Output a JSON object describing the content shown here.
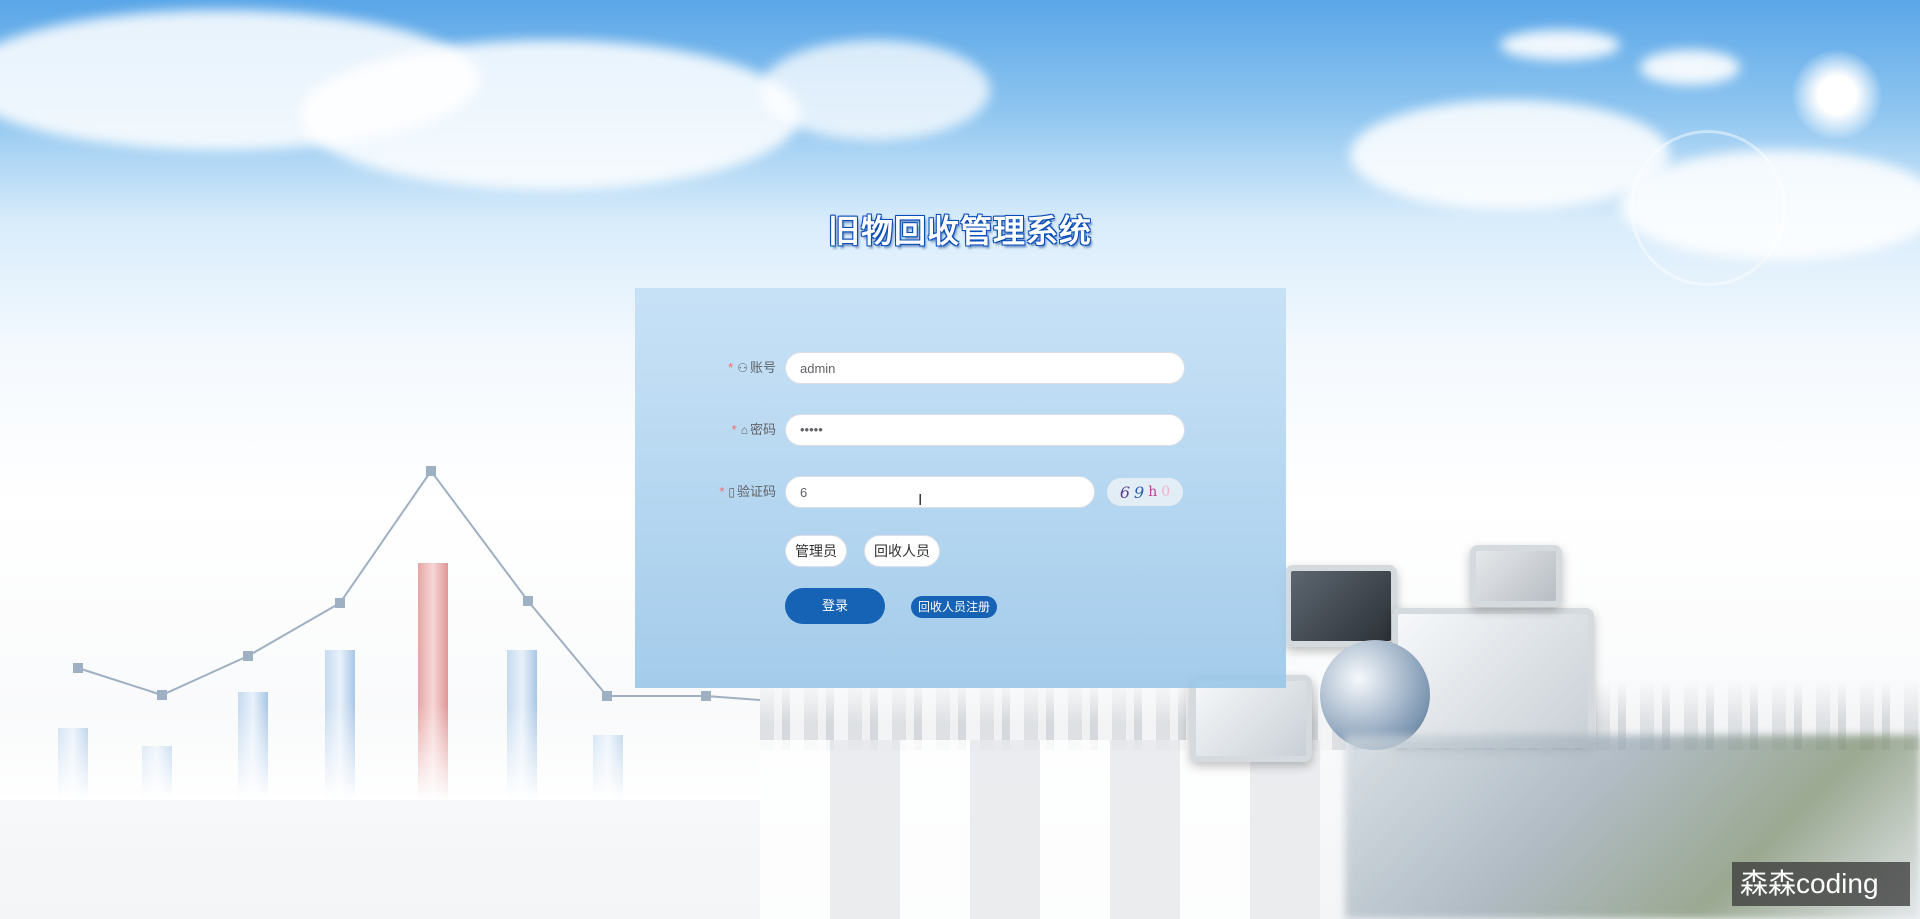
{
  "app": {
    "title": "旧物回收管理系统"
  },
  "form": {
    "account": {
      "label": "账号",
      "icon": "user-icon",
      "value": "admin",
      "required": true
    },
    "password": {
      "label": "密码",
      "icon": "lock-icon",
      "value": "•••••",
      "required": true
    },
    "captcha": {
      "label": "验证码",
      "icon": "document-icon",
      "value": "6",
      "image_chars": [
        "6",
        "9",
        "h",
        "0"
      ],
      "required": true
    }
  },
  "roles": [
    "管理员",
    "回收人员"
  ],
  "buttons": {
    "login": "登录",
    "register": "回收人员注册"
  },
  "watermark": "森森coding",
  "chart": {
    "type": "bar-line"
  },
  "colors": {
    "accent": "#1662b5",
    "required": "#f56c6c",
    "title_stroke": "#0a4db8",
    "highlight_bar": "#e8a5a5"
  }
}
